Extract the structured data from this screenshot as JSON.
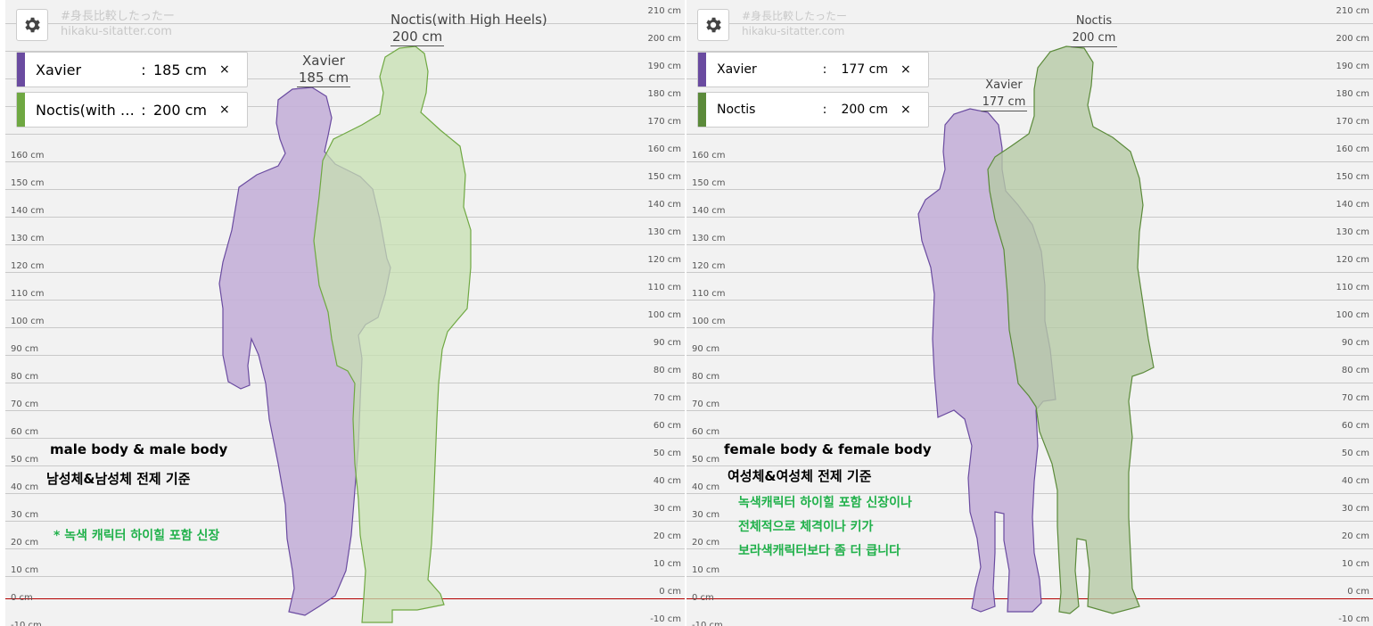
{
  "watermark": {
    "line1": "#身長比較したったー",
    "line2": "hikaku-sitatter.com"
  },
  "colors": {
    "purple": "#6a4ba0",
    "purple_fill": "#c4b0d8",
    "green": "#6fa842",
    "green_fill": "#c6dfb0",
    "green_dark": "#5b8a3a",
    "green_dark_fill": "#b5c9a5",
    "annotation_green": "#21b14b",
    "zero_line": "#b40000"
  },
  "ticks": [
    "210 cm",
    "200 cm",
    "190 cm",
    "180 cm",
    "170 cm",
    "160 cm",
    "150 cm",
    "140 cm",
    "130 cm",
    "120 cm",
    "110 cm",
    "100 cm",
    "90 cm",
    "80 cm",
    "70 cm",
    "60 cm",
    "50 cm",
    "40 cm",
    "30 cm",
    "20 cm",
    "10 cm",
    "0 cm",
    "-10 cm"
  ],
  "left": {
    "entries": [
      {
        "name": "Xavier",
        "colon": ":",
        "height": "185 cm",
        "remove": "×"
      },
      {
        "name": "Noctis(with …",
        "colon": ":",
        "height": "200 cm",
        "remove": "×"
      }
    ],
    "labels": [
      {
        "name": "Xavier",
        "height": "185 cm"
      },
      {
        "name": "Noctis(with High Heels)",
        "height": "200 cm"
      }
    ],
    "annotations": {
      "body_en": "male body & male body",
      "body_ko": "남성체&남성체 전제 기준",
      "note": "* 녹색 캐릭터 하이힐 포함 신장"
    }
  },
  "right": {
    "entries": [
      {
        "name": "Xavier",
        "colon": ":",
        "height": "177 cm",
        "remove": "×"
      },
      {
        "name": "Noctis",
        "colon": ":",
        "height": "200 cm",
        "remove": "×"
      }
    ],
    "labels": [
      {
        "name": "Xavier",
        "height": "177 cm"
      },
      {
        "name": "Noctis",
        "height": "200 cm"
      }
    ],
    "annotations": {
      "body_en": "female body & female body",
      "body_ko": "여성체&여성체 전제 기준",
      "note1": "녹색캐릭터 하이힐 포함 신장이나",
      "note2": "전체적으로 체격이나 키가",
      "note3": "보라색캐릭터보다 좀 더 큽니다"
    }
  }
}
